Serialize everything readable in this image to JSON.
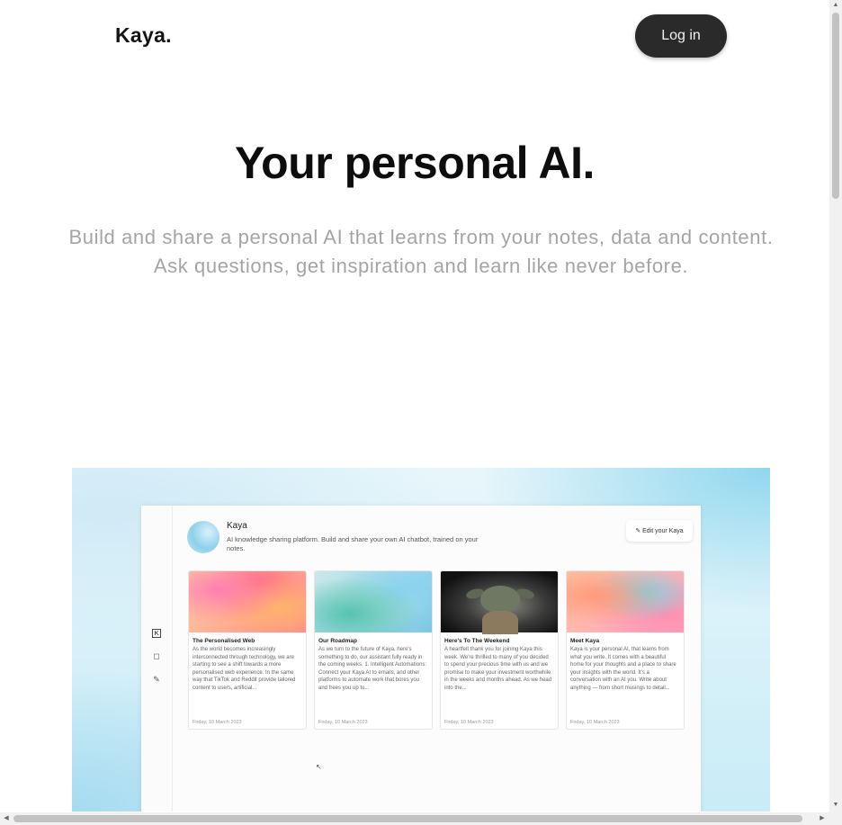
{
  "header": {
    "logo": "Kaya.",
    "login_label": "Log in"
  },
  "hero": {
    "title": "Your personal AI.",
    "subtitle_line1": "Build and share a personal AI that learns from your notes, data and content.",
    "subtitle_line2": "Ask questions, get inspiration and learn like never before."
  },
  "app_preview": {
    "sidebar_icons": [
      "kaya-logo-icon",
      "chat-bubble-icon",
      "pencil-icon"
    ],
    "profile": {
      "name": "Kaya",
      "description": "AI knowledge sharing platform. Build and share your own AI chatbot, trained on your notes."
    },
    "edit_label": "✎ Edit your Kaya",
    "cards": [
      {
        "title": "The Personalised Web",
        "text": "As the world becomes increasingly interconnected through technology, we are starting to see a shift towards a more personalised web experience. In the same way that TikTok and Reddit provide tailored content to users, artificial...",
        "date": "Friday, 10 March 2023"
      },
      {
        "title": "Our Roadmap",
        "text": "As we turn to the future of Kaya, here's something to do, our assistant fully ready in the coming weeks. 1. Intelligent Automations: Connect your Kaya AI to emails, and other platforms to automate work that bores you and frees you up to...",
        "date": "Friday, 10 March 2023"
      },
      {
        "title": "Here's To The Weekend",
        "text": "A heartfelt thank you for joining Kaya this week. We're thrilled to many of you decided to spend your precious time with us and we promise to make your investment worthwhile in the weeks and months ahead. As we head into the...",
        "date": "Friday, 10 March 2023"
      },
      {
        "title": "Meet Kaya",
        "text": "Kaya is your personal AI, that learns from what you write. It comes with a beautiful home for your thoughts and a place to share your insights with the world. It's a conversation with an AI you. Write about anything — from short musings to detail...",
        "date": "Friday, 10 March 2023"
      }
    ]
  }
}
